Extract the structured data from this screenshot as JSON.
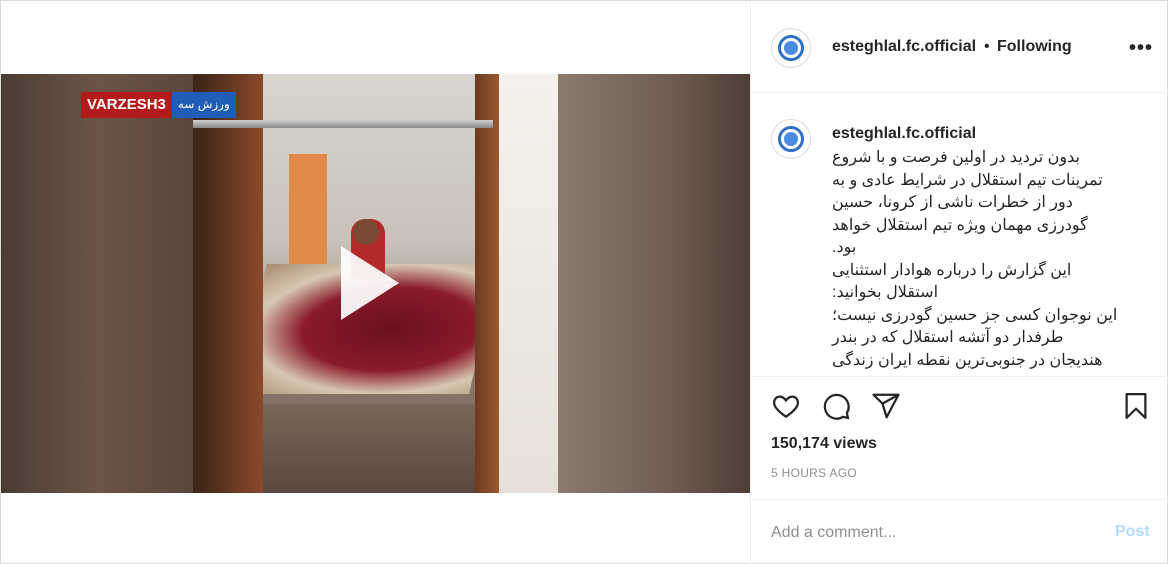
{
  "media": {
    "watermark_brand": "VARZESH3",
    "watermark_sub": "ورزش سه",
    "play_icon": "play-icon"
  },
  "header": {
    "username": "esteghlal.fc.official",
    "separator": "•",
    "follow_status": "Following",
    "more_icon": "more-options-icon"
  },
  "caption": {
    "username": "esteghlal.fc.official",
    "lines": "بدون تردید در اولین فرصت و با شروع\nتمرینات تیم استقلال در شرایط عادی و به\nدور از خطرات ناشی از کرونا، حسین\nگودرزی مهمان ویژه تیم استقلال خواهد\nبود.\nاین گزارش را درباره هوادار استثنایی\nاستقلال بخوانید:\nاین نوجوان کسی جز حسین گودرزی نیست؛\nطرفدار دو آتشه استقلال که در بندر\nهندیجان در جنوبی‌ترین نقطه ایران زندگی"
  },
  "actions": {
    "like_icon": "heart-icon",
    "comment_icon": "comment-icon",
    "share_icon": "share-icon",
    "save_icon": "bookmark-icon"
  },
  "stats": {
    "views": "150,174 views",
    "time_ago": "5 HOURS AGO"
  },
  "comment": {
    "placeholder": "Add a comment...",
    "post_label": "Post"
  },
  "colors": {
    "post_disabled": "#b3dbff",
    "muted": "#8e8e8e",
    "text": "#262626",
    "brand_blue": "#2f6fc4"
  }
}
